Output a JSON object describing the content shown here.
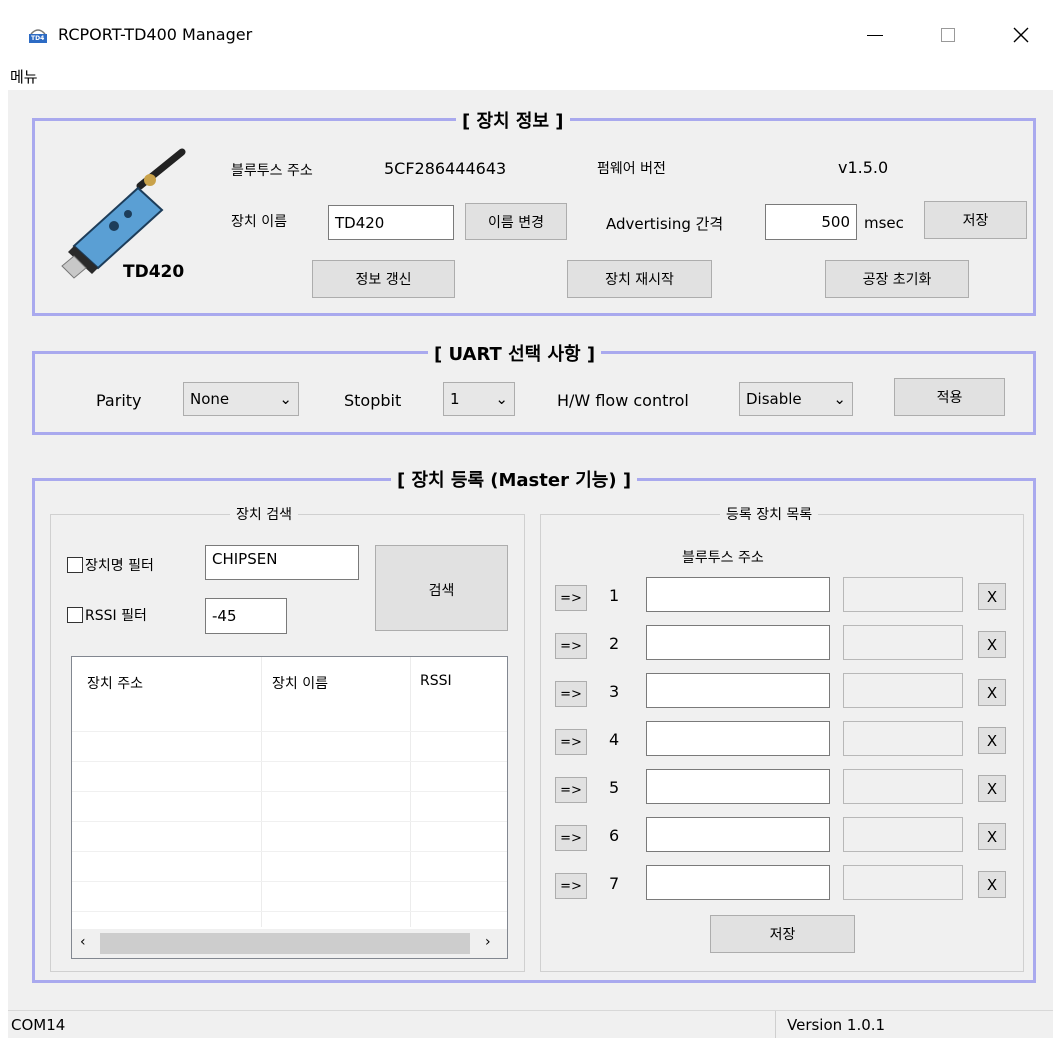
{
  "window": {
    "title": "RCPORT-TD400 Manager",
    "icon_text": "TD4",
    "menu": "메뉴"
  },
  "device_info": {
    "title": "[ 장치 정보 ]",
    "product_name": "TD420",
    "bt_address_label": "블루투스 주소",
    "bt_address_value": "5CF286444643",
    "firmware_label": "펌웨어 버전",
    "firmware_value": "v1.5.0",
    "device_name_label": "장치 이름",
    "device_name_value": "TD420",
    "rename_button": "이름 변경",
    "adv_label": "Advertising 간격",
    "adv_value": "500",
    "adv_unit": "msec",
    "save_button": "저장",
    "refresh_button": "정보 갱신",
    "restart_button": "장치 재시작",
    "factory_reset_button": "공장 초기화"
  },
  "uart": {
    "title": "[ UART 선택 사항 ]",
    "parity_label": "Parity",
    "parity_value": "None",
    "stopbit_label": "Stopbit",
    "stopbit_value": "1",
    "flow_label": "H/W flow control",
    "flow_value": "Disable",
    "apply_button": "적용"
  },
  "registration": {
    "title_prefix": "[ 장치 등록 (",
    "title_bold": "Master",
    "title_suffix": " 기능) ]",
    "search": {
      "title": "장치 검색",
      "name_filter_label": "장치명 필터",
      "name_filter_value": "CHIPSEN",
      "rssi_filter_label": "RSSI 필터",
      "rssi_filter_value": "-45",
      "search_button": "검색",
      "columns": [
        "장치 주소",
        "장치 이름",
        "RSSI"
      ]
    },
    "registered": {
      "title": "등록 장치 목록",
      "header": "블루투스 주소",
      "arrow": "=>",
      "remove": "X",
      "rows": [
        "1",
        "2",
        "3",
        "4",
        "5",
        "6",
        "7"
      ],
      "save_button": "저장"
    }
  },
  "status": {
    "port": "COM14",
    "version": "Version 1.0.1"
  }
}
